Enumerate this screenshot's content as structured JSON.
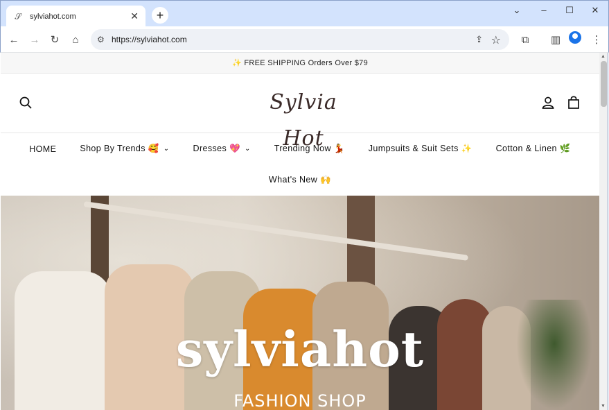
{
  "browser": {
    "tab_title": "sylviahot.com",
    "url": "https://sylviahot.com",
    "icons": [
      "favicon-icon",
      "close-icon",
      "new-tab-icon",
      "chevron-down-icon",
      "minimize-icon",
      "maximize-icon",
      "close-window-icon",
      "back-icon",
      "forward-icon",
      "reload-icon",
      "home-icon",
      "site-info-icon",
      "share-icon",
      "star-icon",
      "extensions-icon",
      "side-panel-icon",
      "profile-icon",
      "menu-icon"
    ]
  },
  "announcement": {
    "text": "✨ FREE SHIPPING Orders Over $79"
  },
  "header": {
    "logo_text": "Sylvia Hot",
    "icons": [
      "search-icon",
      "account-icon",
      "cart-icon"
    ]
  },
  "nav": {
    "row1": [
      {
        "label": "HOME",
        "has_dropdown": false
      },
      {
        "label": "Shop By Trends 🥰",
        "has_dropdown": true
      },
      {
        "label": "Dresses 💖",
        "has_dropdown": true
      },
      {
        "label": "Trending Now 💃",
        "has_dropdown": false
      },
      {
        "label": "Jumpsuits & Suit Sets ✨",
        "has_dropdown": false
      },
      {
        "label": "Cotton & Linen 🌿",
        "has_dropdown": false
      }
    ],
    "row2": [
      {
        "label": "What's New 🙌",
        "has_dropdown": false
      }
    ]
  },
  "hero": {
    "brand": "sylviahot",
    "subtitle": "FASHION SHOP"
  }
}
